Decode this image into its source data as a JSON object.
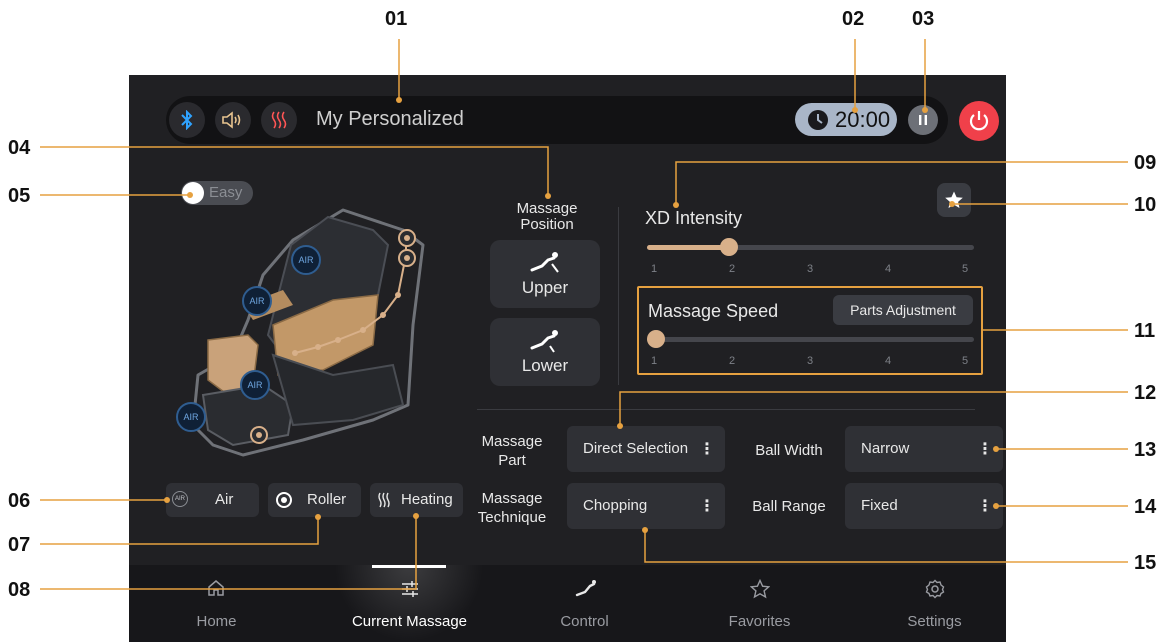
{
  "callouts": [
    "01",
    "02",
    "03",
    "04",
    "05",
    "06",
    "07",
    "08",
    "09",
    "10",
    "11",
    "12",
    "13",
    "14",
    "15"
  ],
  "header": {
    "program_title": "My Personalized",
    "timer": "20:00",
    "icons": [
      "bluetooth-icon",
      "speaker-icon",
      "heating-icon",
      "clock-icon",
      "pause-icon",
      "power-icon"
    ]
  },
  "easy_toggle": {
    "label": "Easy",
    "on": false
  },
  "chair": {
    "air_badge": "AIR"
  },
  "massage_position": {
    "title": "Massage Position",
    "options": [
      {
        "label": "Upper"
      },
      {
        "label": "Lower"
      }
    ]
  },
  "xd_intensity": {
    "title": "XD Intensity",
    "value": 2,
    "ticks": [
      "1",
      "2",
      "3",
      "4",
      "5"
    ]
  },
  "massage_speed": {
    "title": "Massage Speed",
    "value": 1,
    "ticks": [
      "1",
      "2",
      "3",
      "4",
      "5"
    ],
    "parts_button": "Parts Adjustment"
  },
  "settings": {
    "massage_part_label": "Massage Part",
    "massage_part_value": "Direct Selection",
    "massage_technique_label": "Massage Technique",
    "massage_technique_value": "Chopping",
    "ball_width_label": "Ball Width",
    "ball_width_value": "Narrow",
    "ball_range_label": "Ball Range",
    "ball_range_value": "Fixed",
    "menu_glyph": "⋮"
  },
  "chips": {
    "air": "Air",
    "air_icon_text": "AIR",
    "roller": "Roller",
    "heating": "Heating"
  },
  "nav": [
    {
      "label": "Home"
    },
    {
      "label": "Current Massage"
    },
    {
      "label": "Control"
    },
    {
      "label": "Favorites"
    },
    {
      "label": "Settings"
    }
  ],
  "nav_active": "Current Massage",
  "colors": {
    "accent": "#d8b08a",
    "callout_line": "#e6a140",
    "bluetooth": "#2fa3ff",
    "speaker": "#e8c48f",
    "heat": "#ff5555",
    "power": "#f0404a",
    "timer_bg": "#a9b6c8"
  }
}
